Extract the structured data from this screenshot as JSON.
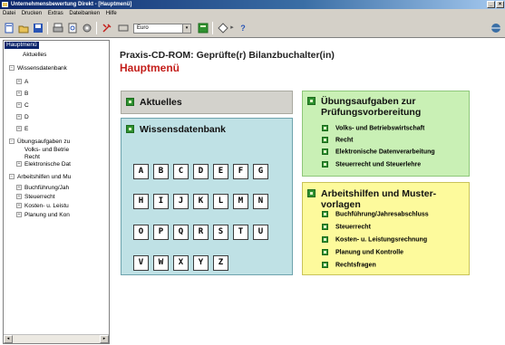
{
  "window": {
    "title": "Unternehmensbewertung Direkt - [Hauptmenü]",
    "min": "_",
    "restore": "▫",
    "close": "×"
  },
  "menu": [
    "Datei",
    "Drucken",
    "Extras",
    "Dateibanken",
    "Hilfe"
  ],
  "toolbar": {
    "combo_value": "Euro",
    "combo_arrow": "▾",
    "arrow_glyph": "▸",
    "help_glyph": "?"
  },
  "tree": {
    "root": "Hauptmenü",
    "items": [
      {
        "label": "Aktuelles"
      },
      {
        "label": "Wissensdatenbank"
      },
      {
        "label": "A"
      },
      {
        "label": "B"
      },
      {
        "label": "C"
      },
      {
        "label": "D"
      },
      {
        "label": "E"
      },
      {
        "label": "Übungsaufgaben zu"
      },
      {
        "label": "Volks- und Betrie"
      },
      {
        "label": "Recht"
      },
      {
        "label": "Elektronische Dat"
      },
      {
        "label": "Arbeitshilfen und Mu"
      },
      {
        "label": "Buchführung/Jah"
      },
      {
        "label": "Steuerrecht"
      },
      {
        "label": "Kosten- u. Leistu"
      },
      {
        "label": "Planung und Kon"
      }
    ],
    "expander": "+",
    "collapser": "−",
    "scroll_left": "◂",
    "scroll_right": "▸"
  },
  "main": {
    "title": "Praxis-CD-ROM: Geprüfte(r) Bilanzbuchalter(in)",
    "subtitle": "Hauptmenü",
    "aktuelles": "Aktuelles",
    "wissensdatenbank": "Wissensdatenbank",
    "letters": [
      "A",
      "B",
      "C",
      "D",
      "E",
      "F",
      "G",
      "H",
      "I",
      "J",
      "K",
      "L",
      "M",
      "N",
      "O",
      "P",
      "Q",
      "R",
      "S",
      "T",
      "U",
      "V",
      "W",
      "X",
      "Y",
      "Z"
    ],
    "uebungsaufgaben": {
      "title_line1": "Übungsaufgaben zur",
      "title_line2": "Prüfungsvorbereitung",
      "items": [
        "Volks- und Betriebswirtschaft",
        "Recht",
        "Elektronische Datenverarbeitung",
        "Steuerrecht und Steuerlehre"
      ]
    },
    "arbeitshilfen": {
      "title_line1": "Arbeitshilfen und Muster-",
      "title_line2": "vorlagen",
      "items": [
        "Buchführung/Jahresabschluss",
        "Steuerrecht",
        "Kosten- u. Leistungsrechnung",
        "Planung und Kontrolle",
        "Rechtsfragen"
      ]
    }
  }
}
